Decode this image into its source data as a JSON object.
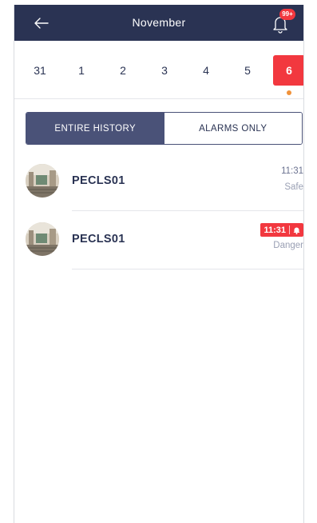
{
  "header": {
    "title": "November",
    "back_icon": "arrow-left-icon",
    "bell_icon": "bell-icon",
    "badge": "99+"
  },
  "dates": [
    "31",
    "1",
    "2",
    "3",
    "4",
    "5",
    "6"
  ],
  "selected_date": "6",
  "tabs": {
    "entire_history": "ENTIRE HISTORY",
    "alarms_only": "ALARMS ONLY",
    "active": "entire_history"
  },
  "events": [
    {
      "name": "PECLS01",
      "time": "11:31",
      "status": "Safe",
      "alarm": false
    },
    {
      "name": "PECLS01",
      "time": "11:31",
      "status": "Danger",
      "alarm": true
    }
  ],
  "colors": {
    "header_bg": "#2a3353",
    "accent_red": "#f2383f",
    "segment_active": "#4a5278",
    "dot": "#f0923a"
  }
}
